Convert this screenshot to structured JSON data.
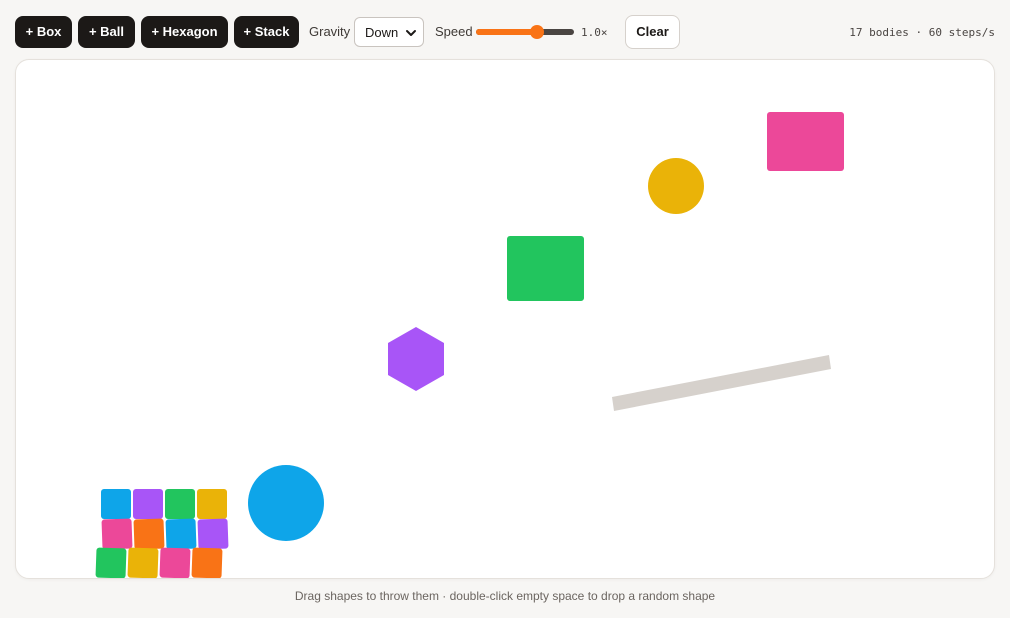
{
  "toolbar": {
    "add_box_label": "+ Box",
    "add_ball_label": "+ Ball",
    "add_hexagon_label": "+ Hexagon",
    "add_stack_label": "+ Stack",
    "gravity_label": "Gravity",
    "gravity_value": "Down",
    "speed_label": "Speed",
    "speed_value": 0.62,
    "speed_readout": "1.0×",
    "clear_label": "Clear",
    "stats": "17 bodies · 60 steps/s"
  },
  "hint": "Drag shapes to throw them · double-click empty space to drop a random shape",
  "colors": {
    "pink": "#ec4899",
    "yellow": "#eab308",
    "green": "#22c55e",
    "purple": "#a855f7",
    "blue": "#0ea5e9",
    "orange": "#f97316",
    "platform": "#d6d1cc",
    "toolbar_button": "#1c1917"
  },
  "bodies": [
    {
      "shape": "box",
      "color": "pink"
    },
    {
      "shape": "ball",
      "color": "yellow"
    },
    {
      "shape": "box",
      "color": "green"
    },
    {
      "shape": "hexagon",
      "color": "purple"
    },
    {
      "shape": "ball",
      "color": "blue"
    },
    {
      "shape": "stack",
      "colors": [
        "blue",
        "purple",
        "green",
        "yellow",
        "pink",
        "orange",
        "blue",
        "purple",
        "green",
        "yellow",
        "pink",
        "orange"
      ]
    }
  ],
  "icons": {
    "gravity_dropdown": "chevron-down-icon"
  }
}
